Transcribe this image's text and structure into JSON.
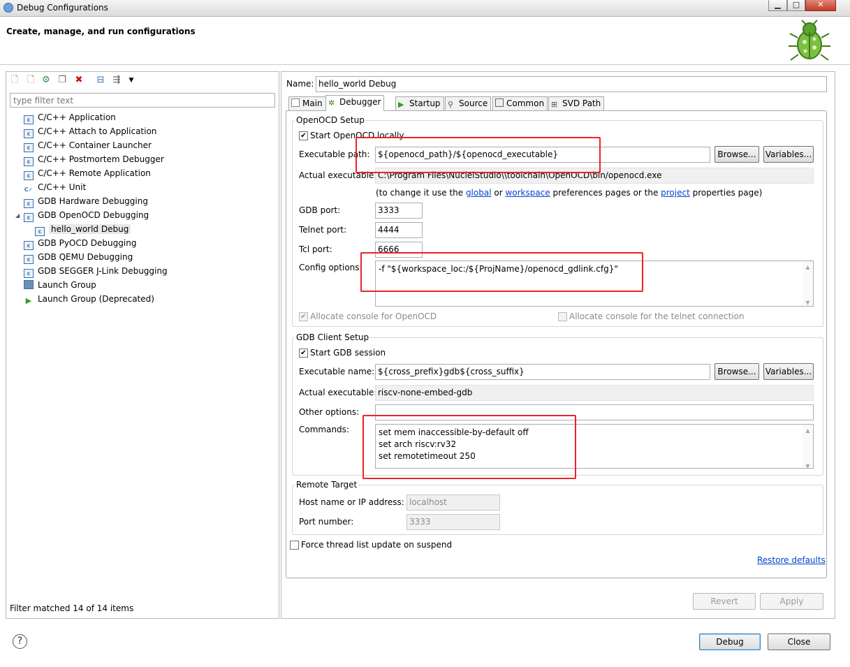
{
  "window": {
    "title": "Debug Configurations",
    "min_label": "▁",
    "max_label": "□",
    "close_label": "✕"
  },
  "banner": {
    "heading": "Create, manage, and run configurations"
  },
  "left": {
    "toolbar_icons": [
      "new-config-icon",
      "new-prototype-icon",
      "export-icon",
      "duplicate-icon",
      "delete-icon",
      "collapse-all-icon",
      "filter-icon",
      "view-menu-icon"
    ],
    "filter_placeholder": "type filter text",
    "tree": [
      {
        "label": "C/C++ Application",
        "icon": "c-config-icon"
      },
      {
        "label": "C/C++ Attach to Application",
        "icon": "c-config-icon"
      },
      {
        "label": "C/C++ Container Launcher",
        "icon": "c-config-icon"
      },
      {
        "label": "C/C++ Postmortem Debugger",
        "icon": "c-config-icon"
      },
      {
        "label": "C/C++ Remote Application",
        "icon": "c-config-icon"
      },
      {
        "label": "C/C++ Unit",
        "icon": "c-unit-icon"
      },
      {
        "label": "GDB Hardware Debugging",
        "icon": "c-config-icon"
      },
      {
        "label": "GDB OpenOCD Debugging",
        "icon": "c-config-icon"
      },
      {
        "label": "hello_world Debug",
        "icon": "c-config-icon"
      },
      {
        "label": "GDB PyOCD Debugging",
        "icon": "c-config-icon"
      },
      {
        "label": "GDB QEMU Debugging",
        "icon": "c-config-icon"
      },
      {
        "label": "GDB SEGGER J-Link Debugging",
        "icon": "c-config-icon"
      },
      {
        "label": "Launch Group",
        "icon": "launch-group-icon"
      },
      {
        "label": "Launch Group (Deprecated)",
        "icon": "run-icon"
      }
    ],
    "status": "Filter matched 14 of 14 items"
  },
  "right": {
    "name_label": "Name:",
    "name_value": "hello_world Debug",
    "tabs": [
      {
        "label": "Main",
        "icon": "main-tab-icon"
      },
      {
        "label": "Debugger",
        "icon": "debugger-tab-icon"
      },
      {
        "label": "Startup",
        "icon": "startup-tab-icon"
      },
      {
        "label": "Source",
        "icon": "source-tab-icon"
      },
      {
        "label": "Common",
        "icon": "common-tab-icon"
      },
      {
        "label": "SVD Path",
        "icon": "svd-tab-icon"
      }
    ],
    "active_tab": "Debugger",
    "openocd": {
      "group_title": "OpenOCD Setup",
      "start_label": "Start OpenOCD locally",
      "exe_path_label": "Executable path:",
      "exe_path_value": "${openocd_path}/${openocd_executable}",
      "browse_label": "Browse...",
      "variables_label": "Variables...",
      "actual_label": "Actual executable:",
      "actual_value": "C:\\Program Files\\NucleiStudio\\\\toolchain\\OpenOCD\\bin/openocd.exe",
      "hint_prefix": "(to change it use the ",
      "hint_global": "global",
      "hint_or": " or ",
      "hint_workspace": "workspace",
      "hint_mid": " preferences pages or the ",
      "hint_project": "project",
      "hint_suffix": " properties page)",
      "gdb_port_label": "GDB port:",
      "gdb_port_value": "3333",
      "telnet_port_label": "Telnet port:",
      "telnet_port_value": "4444",
      "tcl_port_label": "Tcl port:",
      "tcl_port_value": "6666",
      "config_label": "Config options:",
      "config_value": "-f \"${workspace_loc:/${ProjName}/openocd_gdlink.cfg}\"",
      "alloc_console_label": "Allocate console for OpenOCD",
      "alloc_telnet_label": "Allocate console for the telnet connection"
    },
    "gdb": {
      "group_title": "GDB Client Setup",
      "start_label": "Start GDB session",
      "exe_name_label": "Executable name:",
      "exe_name_value": "${cross_prefix}gdb${cross_suffix}",
      "browse_label": "Browse...",
      "variables_label": "Variables...",
      "actual_label": "Actual executable:",
      "actual_value": "riscv-none-embed-gdb",
      "other_label": "Other options:",
      "other_value": "",
      "commands_label": "Commands:",
      "commands_value": "set mem inaccessible-by-default off\nset arch riscv:rv32\nset remotetimeout 250"
    },
    "remote": {
      "group_title": "Remote Target",
      "host_label": "Host name or IP address:",
      "host_value": "localhost",
      "port_label": "Port number:",
      "port_value": "3333"
    },
    "force_thread_label": "Force thread list update on suspend",
    "restore_label": "Restore defaults",
    "revert_label": "Revert",
    "apply_label": "Apply"
  },
  "footer": {
    "help_label": "?",
    "debug_label": "Debug",
    "close_label": "Close"
  },
  "colors": {
    "highlight_box": "#e8242a",
    "link": "#0044cc"
  }
}
